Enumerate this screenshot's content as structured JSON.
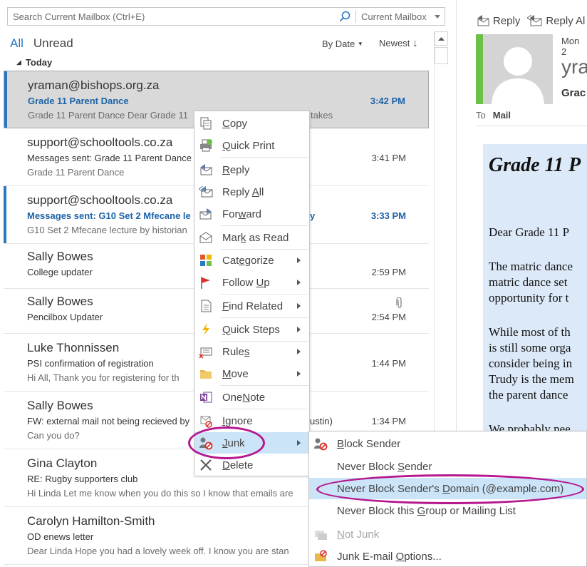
{
  "search": {
    "placeholder": "Search Current Mailbox (Ctrl+E)",
    "scope": "Current Mailbox"
  },
  "filters": {
    "all": "All",
    "unread": "Unread",
    "sort_by": "By Date",
    "sort_order": "Newest"
  },
  "group_header": "Today",
  "messages": [
    {
      "sender": "yraman@bishops.org.za",
      "subject": "Grade 11 Parent Dance",
      "preview": "Grade 11 Parent Dance  Dear Grade 11",
      "preview_tail": "takes",
      "time": "3:42 PM"
    },
    {
      "sender": "support@schooltools.co.za",
      "subject": "Messages sent: Grade 11 Parent Dance",
      "preview": "Grade 11 Parent Dance",
      "time": "3:41 PM"
    },
    {
      "sender": "support@schooltools.co.za",
      "subject": "Messages sent: G10 Set 2 Mfecane le",
      "subject_tail": "y",
      "preview": "G10 Set 2 Mfecane lecture by historian",
      "time": "3:33 PM"
    },
    {
      "sender": "Sally Bowes",
      "subject": "College updater",
      "time": "2:59 PM"
    },
    {
      "sender": "Sally Bowes",
      "subject": "Pencilbox Updater",
      "time": "2:54 PM"
    },
    {
      "sender": "Luke Thonnissen",
      "subject": "PSI confirmation of registration",
      "preview": "Hi All,  Thank you for registering for th",
      "time": "1:44 PM"
    },
    {
      "sender": "Sally Bowes",
      "subject": "FW: external mail not being recieved by",
      "subject_tail": "ustin)",
      "preview": "Can you do?",
      "time": "1:34 PM"
    },
    {
      "sender": "Gina Clayton",
      "subject": "RE: Rugby supporters club",
      "preview": "Hi Linda  Let me know when you do this so I know that emails are"
    },
    {
      "sender": "Carolyn Hamilton-Smith",
      "subject": "OD enews letter",
      "preview": "Dear Linda  Hope you had a lovely week off.  I know you are stan"
    }
  ],
  "context_menu": {
    "copy": {
      "pre": "",
      "key": "C",
      "post": "opy"
    },
    "quick_print": {
      "pre": "",
      "key": "Q",
      "post": "uick Print"
    },
    "reply": {
      "pre": "",
      "key": "R",
      "post": "eply"
    },
    "reply_all": {
      "pre": "Reply ",
      "key": "A",
      "post": "ll"
    },
    "forward": {
      "pre": "For",
      "key": "w",
      "post": "ard"
    },
    "mark_as_read": {
      "pre": "Mar",
      "key": "k",
      "post": " as Read"
    },
    "categorize": {
      "pre": "Cat",
      "key": "e",
      "post": "gorize"
    },
    "follow_up": {
      "pre": "Follow ",
      "key": "U",
      "post": "p"
    },
    "find_related": {
      "pre": "",
      "key": "F",
      "post": "ind Related"
    },
    "quick_steps": {
      "pre": "",
      "key": "Q",
      "post": "uick Steps"
    },
    "rules": {
      "pre": "Rule",
      "key": "s",
      "post": ""
    },
    "move": {
      "pre": "",
      "key": "M",
      "post": "ove"
    },
    "onenote": {
      "pre": "One",
      "key": "N",
      "post": "ote"
    },
    "ignore": {
      "pre": "",
      "key": "I",
      "post": "gnore"
    },
    "junk": {
      "pre": "",
      "key": "J",
      "post": "unk"
    },
    "delete": {
      "pre": "",
      "key": "D",
      "post": "elete"
    }
  },
  "junk_menu": {
    "block_sender": {
      "pre": "",
      "key": "B",
      "post": "lock Sender"
    },
    "never_block_sender": {
      "pre": "Never Block ",
      "key": "S",
      "post": "ender"
    },
    "never_block_domain": {
      "pre": "Never Block Sender's ",
      "key": "D",
      "post": "omain (@example.com)"
    },
    "never_block_group": {
      "pre": "Never Block this ",
      "key": "G",
      "post": "roup or Mailing List"
    },
    "not_junk": {
      "pre": "",
      "key": "N",
      "post": "ot Junk"
    },
    "options": {
      "pre": "Junk E-mail ",
      "key": "O",
      "post": "ptions..."
    }
  },
  "reading_pane": {
    "reply": "Reply",
    "reply_all": "Reply Al",
    "date": "Mon 2",
    "sender": "yra",
    "subject": "Grac",
    "to_label": "To",
    "to_value": "Mail",
    "body_title": "Grade 11 P",
    "body_lines": [
      "Dear Grade 11 P",
      "The matric dance",
      "matric dance set",
      "opportunity for t",
      "While most of th",
      "is still some orga",
      "consider being in",
      "Trudy is the mem",
      "the parent dance",
      "We probably nee"
    ]
  },
  "colors": {
    "accent": "#2b78c2",
    "unread_text": "#1e63a7",
    "highlight": "#cce4f7",
    "annotation": "#b5178f",
    "contact_bar": "#6cc04a",
    "email_body_bg": "#dce9f8"
  }
}
